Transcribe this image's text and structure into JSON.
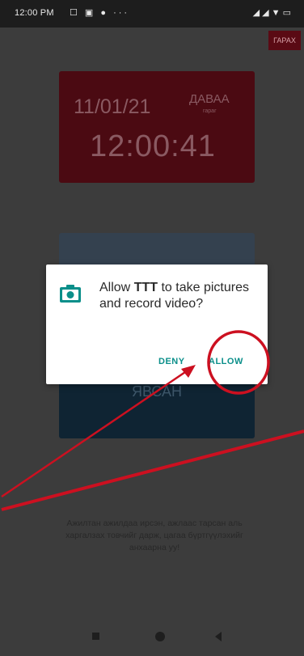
{
  "statusbar": {
    "time": "12:00 PM",
    "icons": "☐ ▣ ● ···",
    "right": "◢ ◢ ▼ ▭"
  },
  "exit_button": "ГАРАХ",
  "clock": {
    "date": "11/01/21",
    "day": "ДАВАА",
    "day_sub": "гараг",
    "time": "12:00:41"
  },
  "card": {
    "label": "ЯВСАН"
  },
  "instruction": "Ажилтан ажилдаа ирсэн, ажлаас тарсан аль харгалзах товчийг дарж, цагаа бүртгүүлэхийг анхаарна уу!",
  "dialog": {
    "text_before": "Allow ",
    "app_name": "TTT",
    "text_after": " to take pictures and record video?",
    "deny": "DENY",
    "allow": "ALLOW"
  },
  "colors": {
    "accent": "#0b8f8a",
    "annotation": "#cc1020",
    "clock_bg": "#4b0a12"
  }
}
